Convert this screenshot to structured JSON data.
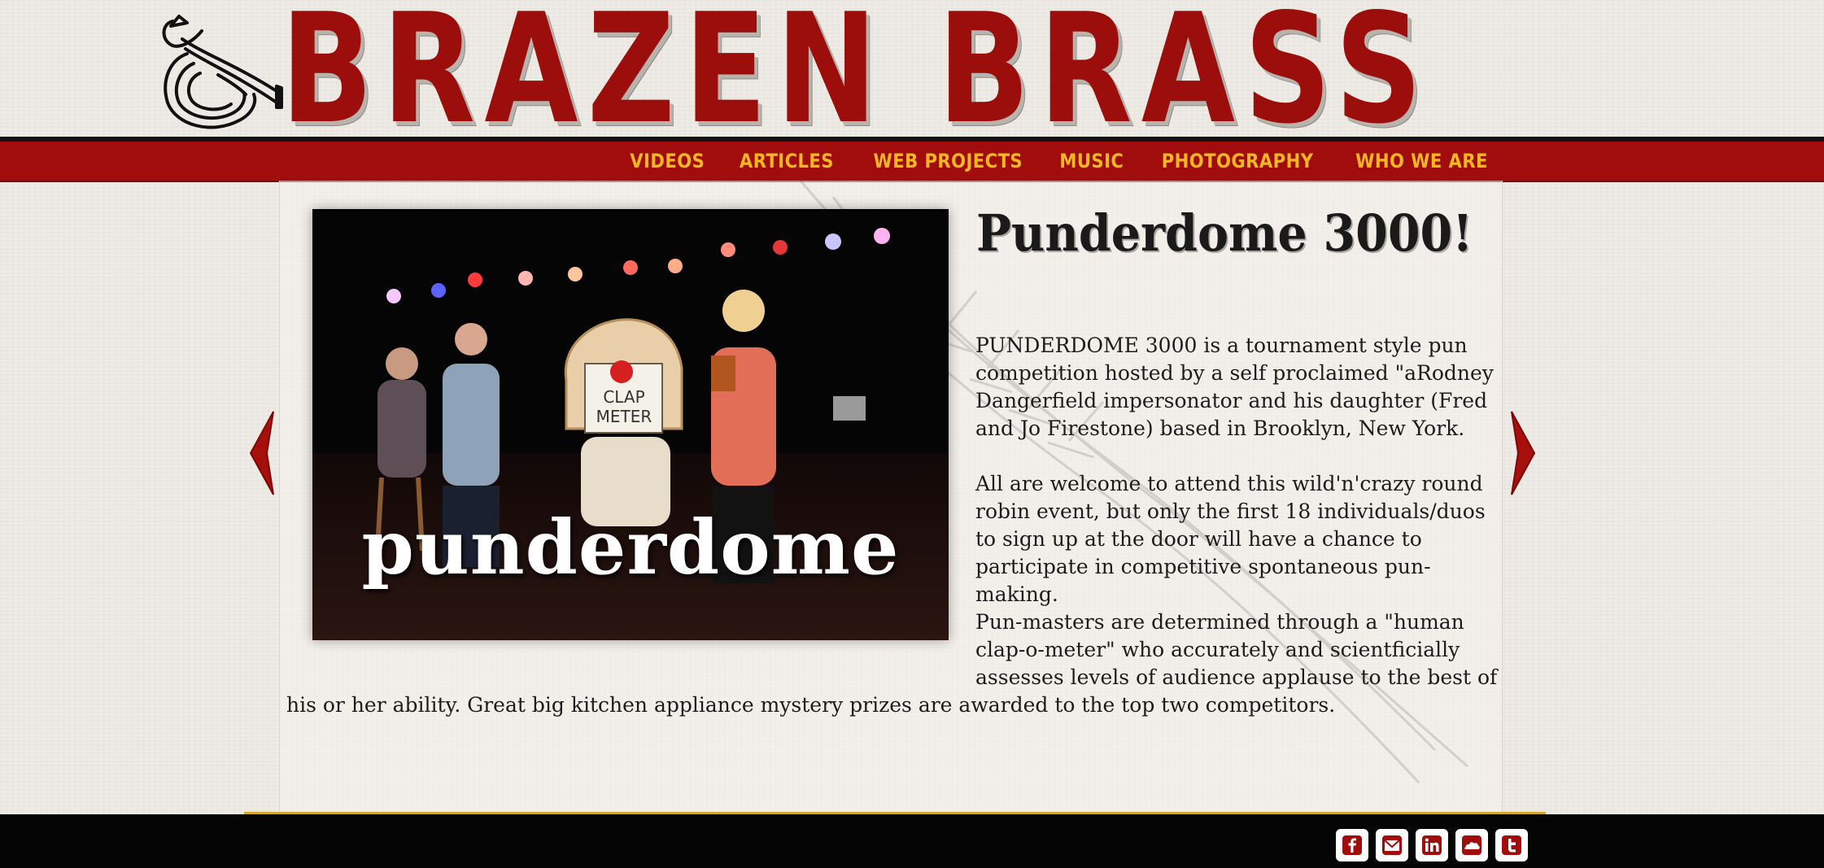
{
  "site": {
    "title": "BRAZEN BRASS"
  },
  "nav": {
    "items": [
      {
        "label": "VIDEOS"
      },
      {
        "label": "ARTICLES"
      },
      {
        "label": "WEB PROJECTS"
      },
      {
        "label": "MUSIC"
      },
      {
        "label": "PHOTOGRAPHY"
      },
      {
        "label": "WHO WE ARE"
      }
    ]
  },
  "slide": {
    "image_caption": "punderdome",
    "title": "Punderdome 3000!",
    "paragraph1": "PUNDERDOME 3000 is a tournament style pun competition hosted by a self proclaimed \"aRodney Dangerfield impersonator and his daughter (Fred and Jo Firestone) based in Brooklyn, New York.",
    "paragraph2": "All are welcome to attend this wild'n'crazy round robin event, but only the first 18 individuals/duos to sign up at the door will have a chance to participate in competitive spontaneous pun-making.",
    "paragraph3_part1": "Pun-masters are determined through a \"human clap-o-meter\" who accurately and scientficially assesses levels of audience applause to the best of",
    "paragraph3_part2": "his or her ability. Great big kitchen appliance mystery prizes are awarded to the top two competitors."
  },
  "colors": {
    "brand_red": "#9b0e0b",
    "nav_red": "#a00d0c",
    "nav_text": "#f3b821",
    "footer": "#050505",
    "footer_rule": "#d2a72a"
  },
  "footer": {
    "social": [
      {
        "icon": "facebook-icon"
      },
      {
        "icon": "email-icon"
      },
      {
        "icon": "linkedin-icon"
      },
      {
        "icon": "cloud-icon"
      },
      {
        "icon": "twitter-icon"
      }
    ]
  }
}
